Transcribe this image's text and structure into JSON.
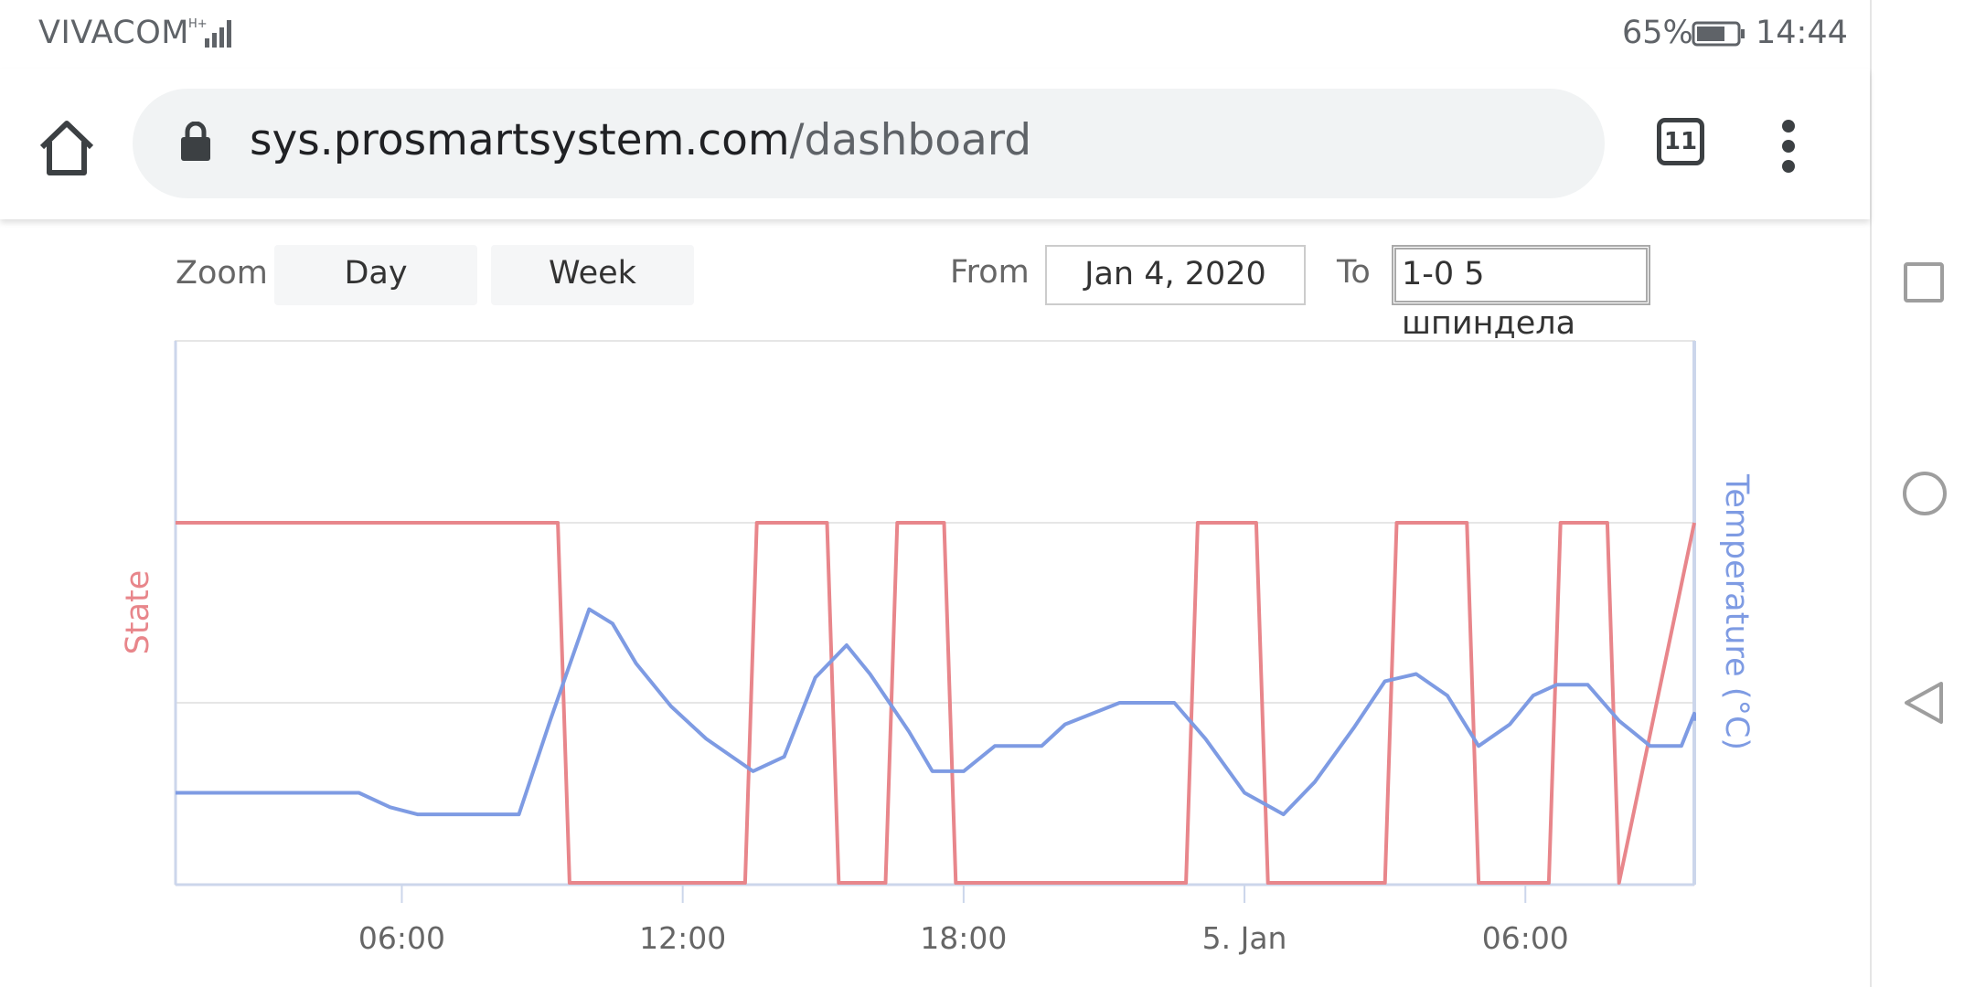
{
  "status_bar": {
    "carrier": "VIVACOM",
    "network": "H+",
    "battery_percent": "65%",
    "time": "14:44"
  },
  "browser": {
    "url_host": "sys.prosmartsystem.com",
    "url_path": "/dashboard",
    "tab_count": "11",
    "icons": [
      "home-icon",
      "lock-icon",
      "tabs-icon",
      "more-vert-icon"
    ]
  },
  "zoom": {
    "label": "Zoom",
    "buttons": [
      "Day",
      "Week"
    ]
  },
  "range": {
    "from_label": "From",
    "from_value": "Jan 4, 2020",
    "to_label": "To",
    "to_value": "1-0 5 шпиндела"
  },
  "android_nav": [
    "recents-icon",
    "home-circle-icon",
    "back-icon"
  ],
  "chart_data": {
    "type": "line",
    "x_tick_labels": [
      "06:00",
      "12:00",
      "18:00",
      "5. Jan",
      "06:00"
    ],
    "x_range": [
      "2020-01-04 01:10",
      "2020-01-05 10:40"
    ],
    "left_axis_label": "State",
    "right_axis_label": "Temperature (°C)",
    "state_range": [
      0,
      1
    ],
    "temperature_range": [
      0,
      1
    ],
    "grid": true,
    "colors": {
      "state": "#e8868b",
      "temperature": "#7e9be3"
    },
    "series": [
      {
        "axis": "State",
        "x": [
          "2020-01-04 01:10",
          "2020-01-04 09:20",
          "2020-01-04 09:35",
          "2020-01-04 13:20",
          "2020-01-04 13:35",
          "2020-01-04 15:05",
          "2020-01-04 15:20",
          "2020-01-04 16:20",
          "2020-01-04 16:35",
          "2020-01-04 17:35",
          "2020-01-04 17:50",
          "2020-01-04 22:45",
          "2020-01-04 23:00",
          "2020-01-05 00:15",
          "2020-01-05 00:30",
          "2020-01-05 03:00",
          "2020-01-05 03:15",
          "2020-01-05 04:45",
          "2020-01-05 05:00",
          "2020-01-05 06:30",
          "2020-01-05 06:45",
          "2020-01-05 07:45",
          "2020-01-05 08:00",
          "2020-01-05 10:40"
        ],
        "values": [
          1,
          1,
          0,
          0,
          1,
          1,
          0,
          0,
          1,
          1,
          0,
          0,
          1,
          1,
          0,
          0,
          1,
          1,
          0,
          0,
          1,
          1,
          0,
          1
        ]
      },
      {
        "axis": "Temperature (°C)",
        "x": [
          "2020-01-04 01:10",
          "2020-01-04 02:00",
          "2020-01-04 05:05",
          "2020-01-04 05:45",
          "2020-01-04 06:20",
          "2020-01-04 08:30",
          "2020-01-04 09:10",
          "2020-01-04 10:00",
          "2020-01-04 10:30",
          "2020-01-04 11:00",
          "2020-01-04 11:45",
          "2020-01-04 12:30",
          "2020-01-04 13:30",
          "2020-01-04 14:10",
          "2020-01-04 14:50",
          "2020-01-04 15:30",
          "2020-01-04 16:00",
          "2020-01-04 16:50",
          "2020-01-04 17:20",
          "2020-01-04 18:00",
          "2020-01-04 18:40",
          "2020-01-04 19:40",
          "2020-01-04 20:10",
          "2020-01-04 21:20",
          "2020-01-04 22:30",
          "2020-01-04 23:10",
          "2020-01-05 00:00",
          "2020-01-05 00:50",
          "2020-01-05 01:30",
          "2020-01-05 02:20",
          "2020-01-05 03:00",
          "2020-01-05 03:40",
          "2020-01-05 04:20",
          "2020-01-05 05:00",
          "2020-01-05 05:40",
          "2020-01-05 06:10",
          "2020-01-05 06:40",
          "2020-01-05 07:20",
          "2020-01-05 08:00",
          "2020-01-05 08:40",
          "2020-01-05 09:20",
          "2020-01-05 10:10",
          "2020-01-05 10:40"
        ],
        "values": [
          0.25,
          0.25,
          0.25,
          0.21,
          0.19,
          0.19,
          0.45,
          0.76,
          0.72,
          0.61,
          0.49,
          0.4,
          0.31,
          0.35,
          0.57,
          0.66,
          0.58,
          0.42,
          0.31,
          0.31,
          0.38,
          0.38,
          0.44,
          0.5,
          0.5,
          0.4,
          0.25,
          0.19,
          0.28,
          0.43,
          0.56,
          0.58,
          0.52,
          0.38,
          0.44,
          0.52,
          0.55,
          0.55,
          0.45,
          0.38,
          0.38,
          0.47,
          0.45
        ]
      }
    ]
  }
}
